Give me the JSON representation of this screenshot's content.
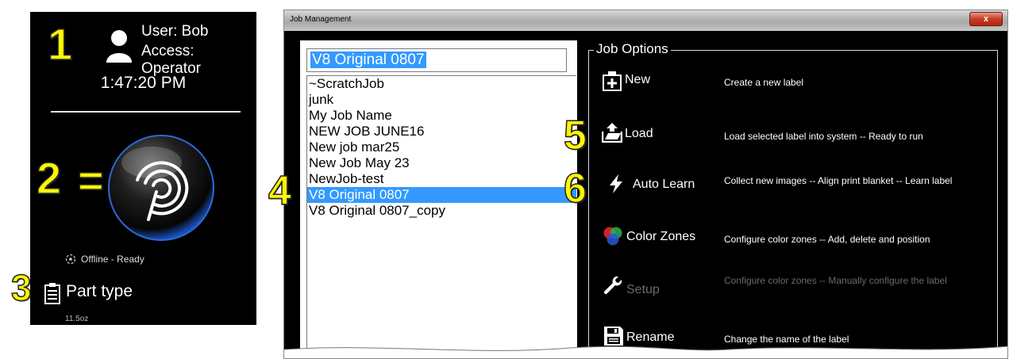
{
  "status_panel": {
    "user_name": "User: Bob",
    "access_level": "Access: Operator",
    "time": "1:47:20 PM",
    "status_text": "Offline - Ready",
    "part_type_label": "Part type",
    "part_type_value": "11.5oz"
  },
  "callouts": {
    "one": "1",
    "two": "2",
    "equals": "=",
    "three": "3",
    "four": "4",
    "five": "5",
    "six": "6"
  },
  "window": {
    "title": "Job Management",
    "close_label": "x"
  },
  "job_list": {
    "input_value": "V8 Original 0807",
    "items": [
      "~ScratchJob",
      "junk",
      "My Job Name",
      "NEW JOB JUNE16",
      "New job mar25",
      "New Job May 23",
      "NewJob-test",
      "V8 Original 0807",
      "V8 Original 0807_copy"
    ],
    "selected_index": 7
  },
  "job_options": {
    "legend": "Job Options",
    "options": [
      {
        "label": "New",
        "description": "Create a new label",
        "icon": "new-label-icon",
        "enabled": true
      },
      {
        "label": "Load",
        "description": "Load selected label into system -- Ready to run",
        "icon": "load-icon",
        "enabled": true
      },
      {
        "label": "Auto Learn",
        "description": "Collect new images -- Align print blanket -- Learn label",
        "icon": "lightning-icon",
        "enabled": true
      },
      {
        "label": "Color Zones",
        "description": "Configure color zones -- Add, delete and position",
        "icon": "color-circles-icon",
        "enabled": true
      },
      {
        "label": "Setup",
        "description": "Configure color zones -- Manually configure the label",
        "icon": "wrench-icon",
        "enabled": false
      },
      {
        "label": "Rename",
        "description": "Change the name of the label",
        "icon": "floppy-disk-icon",
        "enabled": true
      }
    ]
  },
  "colors": {
    "selection": "#3399ff",
    "callout": "#fff700",
    "panel_background": "#000000",
    "disabled_text": "#6a6a6a"
  }
}
